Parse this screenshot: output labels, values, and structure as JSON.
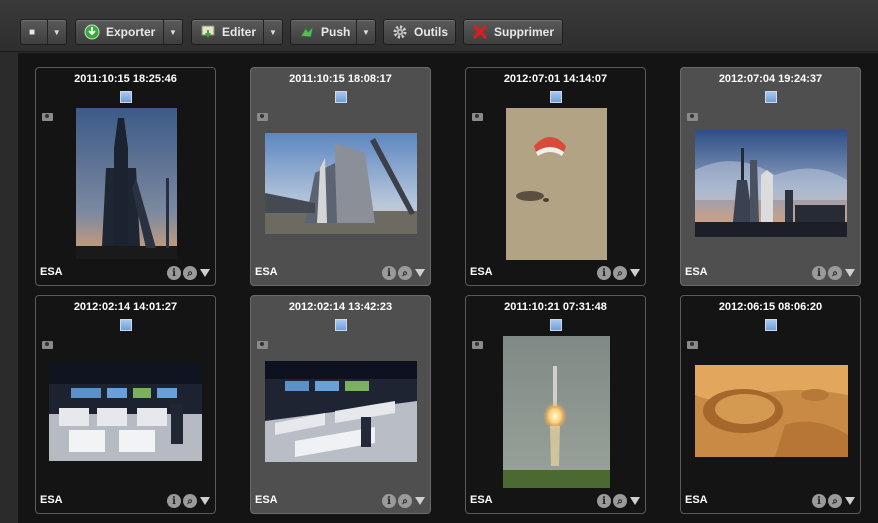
{
  "toolbar": {
    "select_glyph": "■",
    "buttons": [
      {
        "label": "Exporter",
        "icon": "export-icon",
        "has_dropdown": true
      },
      {
        "label": "Editer",
        "icon": "edit-icon",
        "has_dropdown": true
      },
      {
        "label": "Push",
        "icon": "push-icon",
        "has_dropdown": true
      },
      {
        "label": "Outils",
        "icon": "gear-icon",
        "has_dropdown": false
      },
      {
        "label": "Supprimer",
        "icon": "delete-icon",
        "has_dropdown": false
      }
    ]
  },
  "cards": [
    {
      "timestamp": "2011:10:15 18:25:46",
      "credit": "ESA",
      "selected": false,
      "image": "rocket-on-launchpad-dusk"
    },
    {
      "timestamp": "2011:10:15 18:08:17",
      "credit": "ESA",
      "selected": true,
      "image": "rocket-on-launchpad-wide"
    },
    {
      "timestamp": "2012:07:01 14:14:07",
      "credit": "ESA",
      "selected": false,
      "image": "capsule-landing-parachute"
    },
    {
      "timestamp": "2012:07:04 19:24:37",
      "credit": "ESA",
      "selected": true,
      "image": "launch-site-sunset"
    },
    {
      "timestamp": "2012:02:14 14:01:27",
      "credit": "ESA",
      "selected": false,
      "image": "mission-control-room"
    },
    {
      "timestamp": "2012:02:14 13:42:23",
      "credit": "ESA",
      "selected": true,
      "image": "mission-control-room-2"
    },
    {
      "timestamp": "2011:10:21 07:31:48",
      "credit": "ESA",
      "selected": false,
      "image": "rocket-liftoff"
    },
    {
      "timestamp": "2012:06:15 08:06:20",
      "credit": "ESA",
      "selected": false,
      "image": "mars-crater"
    }
  ],
  "colors": {
    "background": "#2b2b2b",
    "grid": "#141414",
    "card_selected": "#4f4f4f",
    "checkbox": "#7aa8e0",
    "delete_red": "#d42020",
    "export_green": "#3aa83a"
  }
}
